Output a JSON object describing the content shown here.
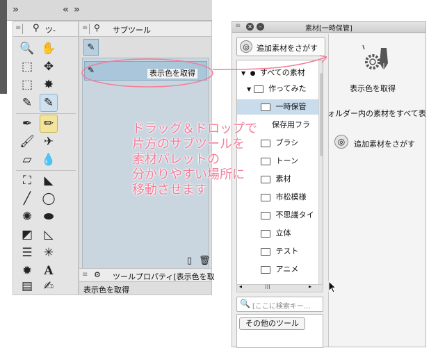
{
  "tool_panel": {
    "tab_label": "ツ-"
  },
  "sub_tool_panel": {
    "tab_label": "サブツール",
    "item_label": "表示色を取得"
  },
  "tool_property": {
    "tab_label": "ツールプロパティ[表示色を取",
    "value": "表示色を取得"
  },
  "material_palette": {
    "title": "素材[一時保管]",
    "search_button": "追加素材をさがす",
    "tree": [
      "すべての素材",
      "作ってみた",
      "一時保管",
      "保存用フラ",
      "ブラシ",
      "トーン",
      "素材",
      "市松模様",
      "不思議タイ",
      "立体",
      "テスト",
      "アニメ"
    ],
    "tag_search_placeholder": "[ここに検索キー…",
    "tag_item": "その他のツール",
    "material_item": "表示色を取得",
    "folder_message": "ォルダー内の素材をすべて表",
    "add_material_link": "追加素材をさがす",
    "scroll_marker": "III"
  },
  "annotation": {
    "line1": "ドラッグ＆ドロップで",
    "line2": "片方のサブツールを",
    "line3": "素材パレットの",
    "line4": "分かりやすい場所に",
    "line5": "移動させます"
  },
  "colors": {
    "annotation": "#f27e98",
    "selection": "#aac6da",
    "highlight_tool": "#f3e49c"
  }
}
